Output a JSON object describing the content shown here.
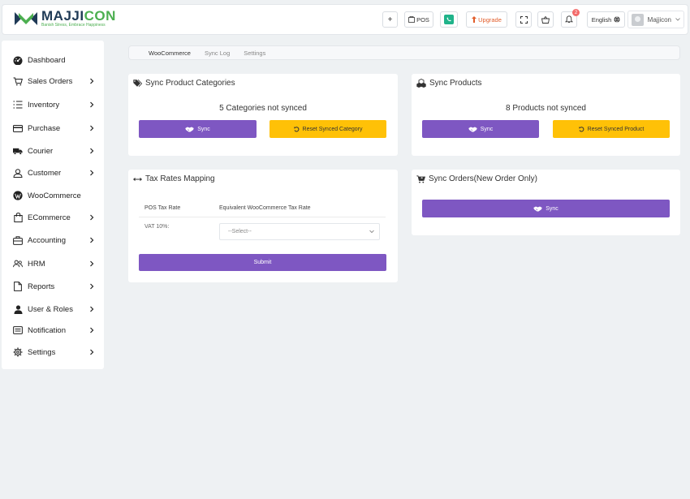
{
  "brand": {
    "name_dark": "MAJJI",
    "name_accent": "CON",
    "tagline": "Banish Stress, Embrace Happiness",
    "colors": {
      "primary": "#7e57c2",
      "warning": "#ffc107",
      "brand_dark": "#1f3a56",
      "brand_accent": "#4caf50"
    }
  },
  "header": {
    "add_label": "+",
    "pos_label": "POS",
    "upgrade_label": "Upgrade",
    "notification_count": "2",
    "language_label": "English",
    "user_name": "Majjicon"
  },
  "sidebar": {
    "items": [
      {
        "label": "Dashboard",
        "icon": "dashboard-icon",
        "has_children": false
      },
      {
        "label": "Sales Orders",
        "icon": "cart-icon",
        "has_children": true
      },
      {
        "label": "Inventory",
        "icon": "list-icon",
        "has_children": true
      },
      {
        "label": "Purchase",
        "icon": "card-icon",
        "has_children": true
      },
      {
        "label": "Courier",
        "icon": "truck-icon",
        "has_children": true
      },
      {
        "label": "Customer",
        "icon": "user-icon",
        "has_children": true
      },
      {
        "label": "WooCommerce",
        "icon": "wordpress-icon",
        "has_children": false
      },
      {
        "label": "ECommerce",
        "icon": "bag-icon",
        "has_children": true
      },
      {
        "label": "Accounting",
        "icon": "briefcase-icon",
        "has_children": true
      },
      {
        "label": "HRM",
        "icon": "users-icon",
        "has_children": true
      },
      {
        "label": "Reports",
        "icon": "file-icon",
        "has_children": true
      },
      {
        "label": "User & Roles",
        "icon": "user-solid-icon",
        "has_children": true
      },
      {
        "label": "Notification",
        "icon": "message-icon",
        "has_children": true
      },
      {
        "label": "Settings",
        "icon": "gear-icon",
        "has_children": true
      }
    ]
  },
  "tabs": [
    {
      "label": "WooCommerce",
      "active": true
    },
    {
      "label": "Sync Log",
      "active": false
    },
    {
      "label": "Settings",
      "active": false
    }
  ],
  "sync_categories": {
    "title": "Sync Product Categories",
    "status": "5 Categories not synced",
    "sync_label": "Sync",
    "reset_label": "Reset Synced Category"
  },
  "sync_products": {
    "title": "Sync Products",
    "status": "8 Products not synced",
    "sync_label": "Sync",
    "reset_label": "Reset Synced Product"
  },
  "tax_mapping": {
    "title": "Tax Rates Mapping",
    "columns": [
      "POS Tax Rate",
      "Equivalent WooCommerce Tax Rate"
    ],
    "rows": [
      {
        "pos_rate": "VAT 10%:",
        "woo_rate": "--Select--"
      }
    ],
    "submit_label": "Submit"
  },
  "sync_orders": {
    "title": "Sync Orders(New Order Only)",
    "sync_label": "Sync"
  }
}
